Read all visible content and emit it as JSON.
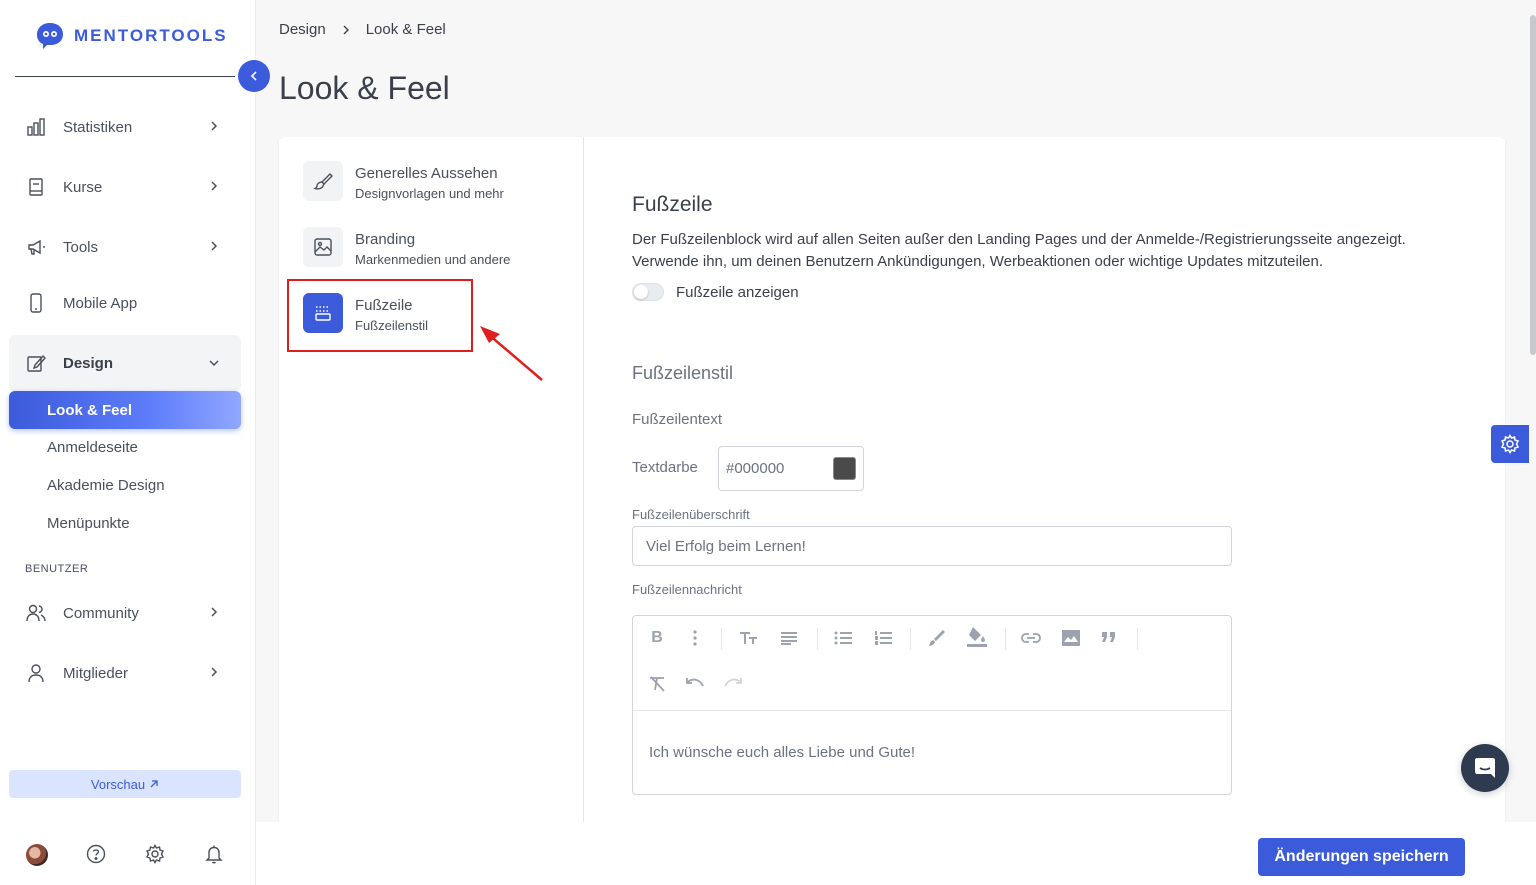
{
  "brand": {
    "name": "MENTORTOOLS",
    "color": "#3b5bdb"
  },
  "sidebar": {
    "items": [
      {
        "label": "Statistiken",
        "icon": "bar-chart-icon"
      },
      {
        "label": "Kurse",
        "icon": "book-icon"
      },
      {
        "label": "Tools",
        "icon": "megaphone-icon"
      },
      {
        "label": "Mobile App",
        "icon": "phone-icon"
      },
      {
        "label": "Design",
        "icon": "edit-icon"
      }
    ],
    "design_sub": [
      "Look & Feel",
      "Anmeldeseite",
      "Akademie Design",
      "Menüpunkte"
    ],
    "section_label": "BENUTZER",
    "user_items": [
      {
        "label": "Community",
        "icon": "users-icon"
      },
      {
        "label": "Mitglieder",
        "icon": "user-icon"
      }
    ],
    "preview_label": "Vorschau"
  },
  "breadcrumb": {
    "parent": "Design",
    "current": "Look & Feel"
  },
  "page_title": "Look & Feel",
  "subnav": [
    {
      "title": "Generelles Aussehen",
      "desc": "Designvorlagen und mehr"
    },
    {
      "title": "Branding",
      "desc": "Markenmedien und andere"
    },
    {
      "title": "Fußzeile",
      "desc": "Fußzeilenstil"
    }
  ],
  "footer_section": {
    "title": "Fußzeile",
    "desc_line1": "Der Fußzeilenblock wird auf allen Seiten außer den Landing Pages und der Anmelde-/Registrierungsseite angezeigt.",
    "desc_line2": "Verwende ihn, um deinen Benutzern Ankündigungen, Werbeaktionen oder wichtige Updates mitzuteilen.",
    "toggle_label": "Fußzeile anzeigen",
    "toggle_on": false,
    "style_title": "Fußzeilenstil",
    "text_label": "Fußzeilentext",
    "color_label": "Textdarbe",
    "color_value": "#000000",
    "heading_label": "Fußzeilenüberschrift",
    "heading_placeholder": "Viel Erfolg beim Lernen!",
    "message_label": "Fußzeilennachricht",
    "message_value": "Ich wünsche euch alles Liebe und Gute!"
  },
  "save_label": "Änderungen speichern"
}
